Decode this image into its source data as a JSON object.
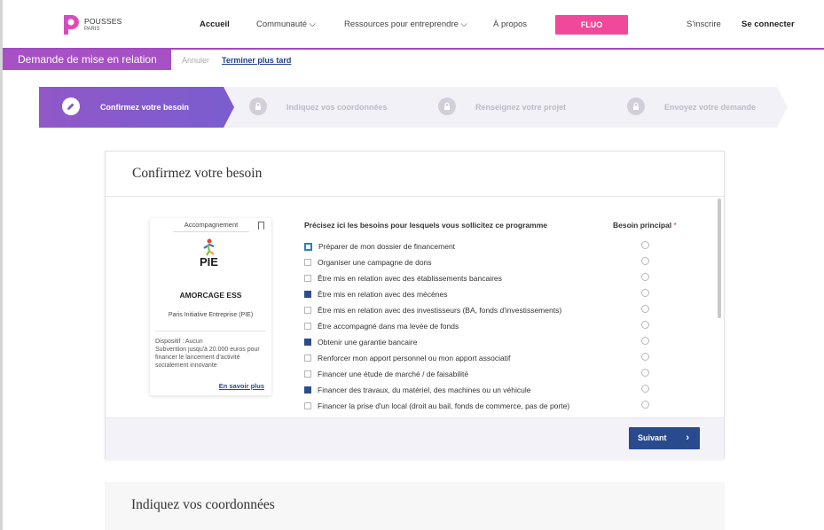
{
  "header": {
    "logo": {
      "line1": "POUSSES",
      "line2": "PARIS"
    },
    "nav": [
      {
        "label": "Accueil"
      },
      {
        "label": "Communauté ⌵"
      },
      {
        "label": "Ressources pour entreprendre ⌵"
      },
      {
        "label": "À propos"
      }
    ],
    "fluo_label": "FLUO",
    "signup_label": "S'inscrire",
    "login_label": "Se connecter",
    "colors": {
      "accent": "#a651c4",
      "fluo": "#f0489a",
      "primary": "#2a4a8e"
    }
  },
  "subbar": {
    "title": "Demande de mise en relation",
    "cancel_label": "Annuler",
    "later_label": "Terminer plus tard"
  },
  "stepper": {
    "steps": [
      {
        "label": "Confirmez votre besoin",
        "icon": "pencil-icon",
        "active": true
      },
      {
        "label": "Indiquez vos coordonnées",
        "icon": "lock-icon",
        "active": false
      },
      {
        "label": "Renseignez votre projet",
        "icon": "lock-icon",
        "active": false
      },
      {
        "label": "Envoyez votre demande",
        "icon": "lock-icon",
        "active": false
      }
    ]
  },
  "card": {
    "title": "Confirmez votre besoin",
    "program": {
      "tag": "Accompagnement",
      "logo_text": "PIE",
      "name": "AMORCAGE ESS",
      "org": "Paris Initiative Entreprise (PIE)",
      "dispositif": "Dispositif : Aucun",
      "description": "Subvention jusqu'à 20.000 euros pour financer le lancement d'activité socialement innovante",
      "link_label": "En savoir plus"
    },
    "list_header": "Précisez ici les besoins pour lesquels vous sollicitez ce programme",
    "main_header": "Besoin principal",
    "required_mark": "*",
    "needs": [
      {
        "label": "Préparer de mon dossier de financement",
        "checked": false,
        "focused": true
      },
      {
        "label": "Organiser une campagne de dons",
        "checked": false,
        "focused": false
      },
      {
        "label": "Être mis en relation avec des établissements bancaires",
        "checked": false,
        "focused": false
      },
      {
        "label": "Être mis en relation avec des mécènes",
        "checked": true,
        "focused": false
      },
      {
        "label": "Être mis en relation avec des investisseurs (BA, fonds d'investissements)",
        "checked": false,
        "focused": false
      },
      {
        "label": "Être accompagné dans ma levée de fonds",
        "checked": false,
        "focused": false
      },
      {
        "label": "Obtenir une garantie bancaire",
        "checked": true,
        "focused": false
      },
      {
        "label": "Renforcer mon apport personnel ou mon apport associatif",
        "checked": false,
        "focused": false
      },
      {
        "label": "Financer une étude de marché / de faisabilité",
        "checked": false,
        "focused": false
      },
      {
        "label": "Financer des travaux, du matériel, des machines ou un véhicule",
        "checked": true,
        "focused": false
      },
      {
        "label": "Financer la prise d'un local (droit au bail, fonds de commerce, pas de porte)",
        "checked": false,
        "focused": false
      }
    ],
    "next_label": "Suivant",
    "next_icon": "chevron-right-icon"
  },
  "section2": {
    "title": "Indiquez vos coordonnées"
  }
}
